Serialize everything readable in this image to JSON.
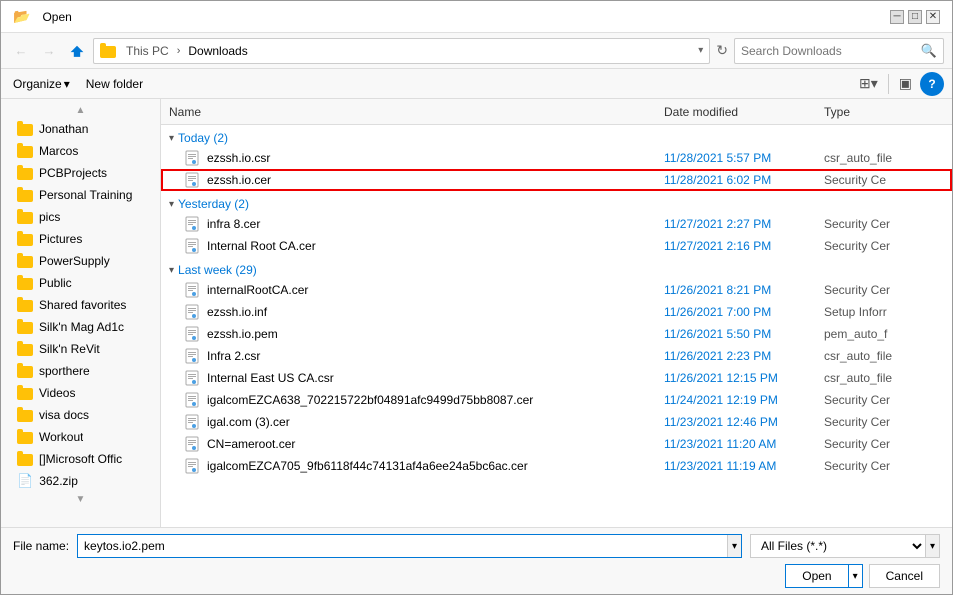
{
  "window": {
    "title": "Open",
    "close_btn": "✕",
    "min_btn": "─",
    "max_btn": "□"
  },
  "toolbar": {
    "back_icon": "←",
    "forward_icon": "→",
    "up_icon": "↑",
    "breadcrumb": "This PC  ›  Downloads",
    "this_pc": "This PC",
    "separator": "›",
    "downloads": "Downloads",
    "refresh_icon": "↻",
    "search_placeholder": "Search Downloads",
    "search_icon": "🔍"
  },
  "toolbar2": {
    "organize_label": "Organize",
    "organize_chevron": "▾",
    "new_folder_label": "New folder",
    "view_icon": "⊞",
    "view_chevron": "▾",
    "pane_icon": "▣",
    "help_icon": "?"
  },
  "sidebar": {
    "items": [
      {
        "id": "jonathan",
        "label": "Jonathan",
        "icon": "folder"
      },
      {
        "id": "marcos",
        "label": "Marcos",
        "icon": "folder"
      },
      {
        "id": "pcbprojects",
        "label": "PCBProjects",
        "icon": "folder"
      },
      {
        "id": "personal-training",
        "label": "Personal Training",
        "icon": "folder"
      },
      {
        "id": "pics",
        "label": "pics",
        "icon": "folder"
      },
      {
        "id": "pictures",
        "label": "Pictures",
        "icon": "folder"
      },
      {
        "id": "powersupply",
        "label": "PowerSupply",
        "icon": "folder"
      },
      {
        "id": "public",
        "label": "Public",
        "icon": "folder"
      },
      {
        "id": "shared-favorites",
        "label": "Shared favorites",
        "icon": "folder"
      },
      {
        "id": "silkn-mag",
        "label": "Silk'n Mag Ad1c",
        "icon": "folder"
      },
      {
        "id": "silkn-revit",
        "label": "Silk'n ReVit",
        "icon": "folder"
      },
      {
        "id": "sporthere",
        "label": "sporthere",
        "icon": "folder"
      },
      {
        "id": "videos",
        "label": "Videos",
        "icon": "folder"
      },
      {
        "id": "visa-docs",
        "label": "visa docs",
        "icon": "folder"
      },
      {
        "id": "workout",
        "label": "Workout",
        "icon": "folder"
      },
      {
        "id": "ms-office",
        "label": "[]Microsoft Offic",
        "icon": "folder"
      },
      {
        "id": "362zip",
        "label": "362.zip",
        "icon": "file"
      }
    ]
  },
  "columns": {
    "name": "Name",
    "date_modified": "Date modified",
    "type": "Type"
  },
  "groups": [
    {
      "id": "today",
      "label": "Today (2)",
      "files": [
        {
          "id": "f1",
          "name": "ezssh.io.csr",
          "date": "11/28/2021 5:57 PM",
          "type": "csr_auto_file",
          "selected": false,
          "icon": "cert"
        },
        {
          "id": "f2",
          "name": "ezssh.io.cer",
          "date": "11/28/2021 6:02 PM",
          "type": "Security Ce",
          "selected": true,
          "icon": "cert"
        }
      ]
    },
    {
      "id": "yesterday",
      "label": "Yesterday (2)",
      "files": [
        {
          "id": "f3",
          "name": "infra 8.cer",
          "date": "11/27/2021 2:27 PM",
          "type": "Security Cer",
          "selected": false,
          "icon": "cert"
        },
        {
          "id": "f4",
          "name": "Internal Root CA.cer",
          "date": "11/27/2021 2:16 PM",
          "type": "Security Cer",
          "selected": false,
          "icon": "cert"
        }
      ]
    },
    {
      "id": "last-week",
      "label": "Last week (29)",
      "files": [
        {
          "id": "f5",
          "name": "internalRootCA.cer",
          "date": "11/26/2021 8:21 PM",
          "type": "Security Cer",
          "selected": false,
          "icon": "cert"
        },
        {
          "id": "f6",
          "name": "ezssh.io.inf",
          "date": "11/26/2021 7:00 PM",
          "type": "Setup Inforr",
          "selected": false,
          "icon": "cert"
        },
        {
          "id": "f7",
          "name": "ezssh.io.pem",
          "date": "11/26/2021 5:50 PM",
          "type": "pem_auto_f",
          "selected": false,
          "icon": "cert"
        },
        {
          "id": "f8",
          "name": "Infra 2.csr",
          "date": "11/26/2021 2:23 PM",
          "type": "csr_auto_file",
          "selected": false,
          "icon": "cert"
        },
        {
          "id": "f9",
          "name": "Internal East US CA.csr",
          "date": "11/26/2021 12:15 PM",
          "type": "csr_auto_file",
          "selected": false,
          "icon": "cert"
        },
        {
          "id": "f10",
          "name": "igalcomEZCA638_702215722bf04891afc9499d75bb8087.cer",
          "date": "11/24/2021 12:19 PM",
          "type": "Security Cer",
          "selected": false,
          "icon": "cert"
        },
        {
          "id": "f11",
          "name": "igal.com (3).cer",
          "date": "11/23/2021 12:46 PM",
          "type": "Security Cer",
          "selected": false,
          "icon": "cert"
        },
        {
          "id": "f12",
          "name": "CN=ameroot.cer",
          "date": "11/23/2021 11:20 AM",
          "type": "Security Cer",
          "selected": false,
          "icon": "cert"
        },
        {
          "id": "f13",
          "name": "igalcomEZCA705_9fb6118f44c74131af4a6ee24a5bc6ac.cer",
          "date": "11/23/2021 11:19 AM",
          "type": "Security Cer",
          "selected": false,
          "icon": "cert"
        }
      ]
    }
  ],
  "bottom": {
    "filename_label": "File name:",
    "filename_value": "keytos.io2.pem",
    "filetype_value": "All Files (*.*)",
    "open_label": "Open",
    "cancel_label": "Cancel"
  }
}
